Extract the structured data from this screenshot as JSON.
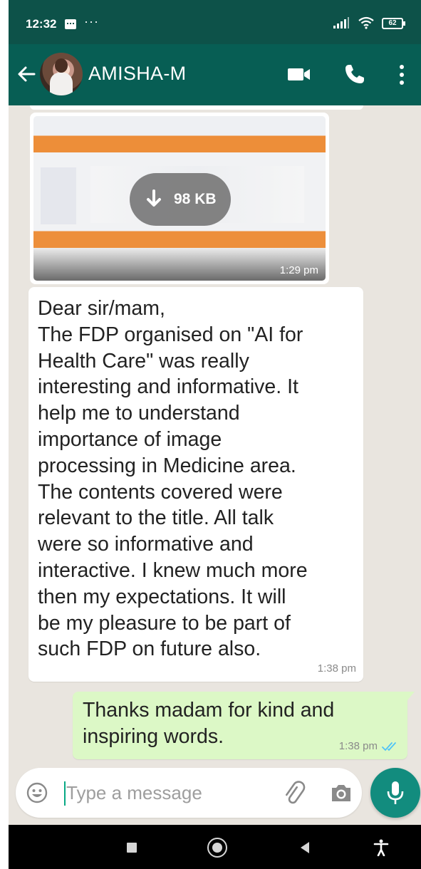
{
  "status_bar": {
    "time": "12:32",
    "more": "···",
    "battery": "62"
  },
  "header": {
    "contact_name": "AMISHA-M"
  },
  "messages": {
    "image": {
      "size": "98 KB",
      "time": "1:29 pm"
    },
    "incoming": {
      "text": "Dear sir/mam,\nThe FDP organised on \"AI for\nHealth Care\" was really\ninteresting and informative. It\nhelp me to understand\nimportance of image\nprocessing in Medicine area.\nThe contents covered were\nrelevant to the title. All talk\nwere so informative and\ninteractive. I knew much more\nthen my expectations. It will\nbe my pleasure to be part of\nsuch FDP on future also.",
      "time": "1:38 pm"
    },
    "outgoing": {
      "text": "Thanks madam for kind and\ninspiring words.",
      "time": "1:38 pm",
      "status": "read"
    }
  },
  "composer": {
    "placeholder": "Type a message"
  },
  "colors": {
    "header": "#075e54",
    "status_bar": "#0d5249",
    "chat_background": "#e9e5df",
    "outgoing_bubble": "#dcf8c6",
    "accent": "#128c7e",
    "read_ticks": "#4fc3f7"
  },
  "icons": [
    "back-arrow-icon",
    "video-call-icon",
    "phone-icon",
    "more-vert-icon",
    "download-icon",
    "emoji-icon",
    "attach-icon",
    "camera-icon",
    "mic-icon",
    "double-tick-icon"
  ]
}
